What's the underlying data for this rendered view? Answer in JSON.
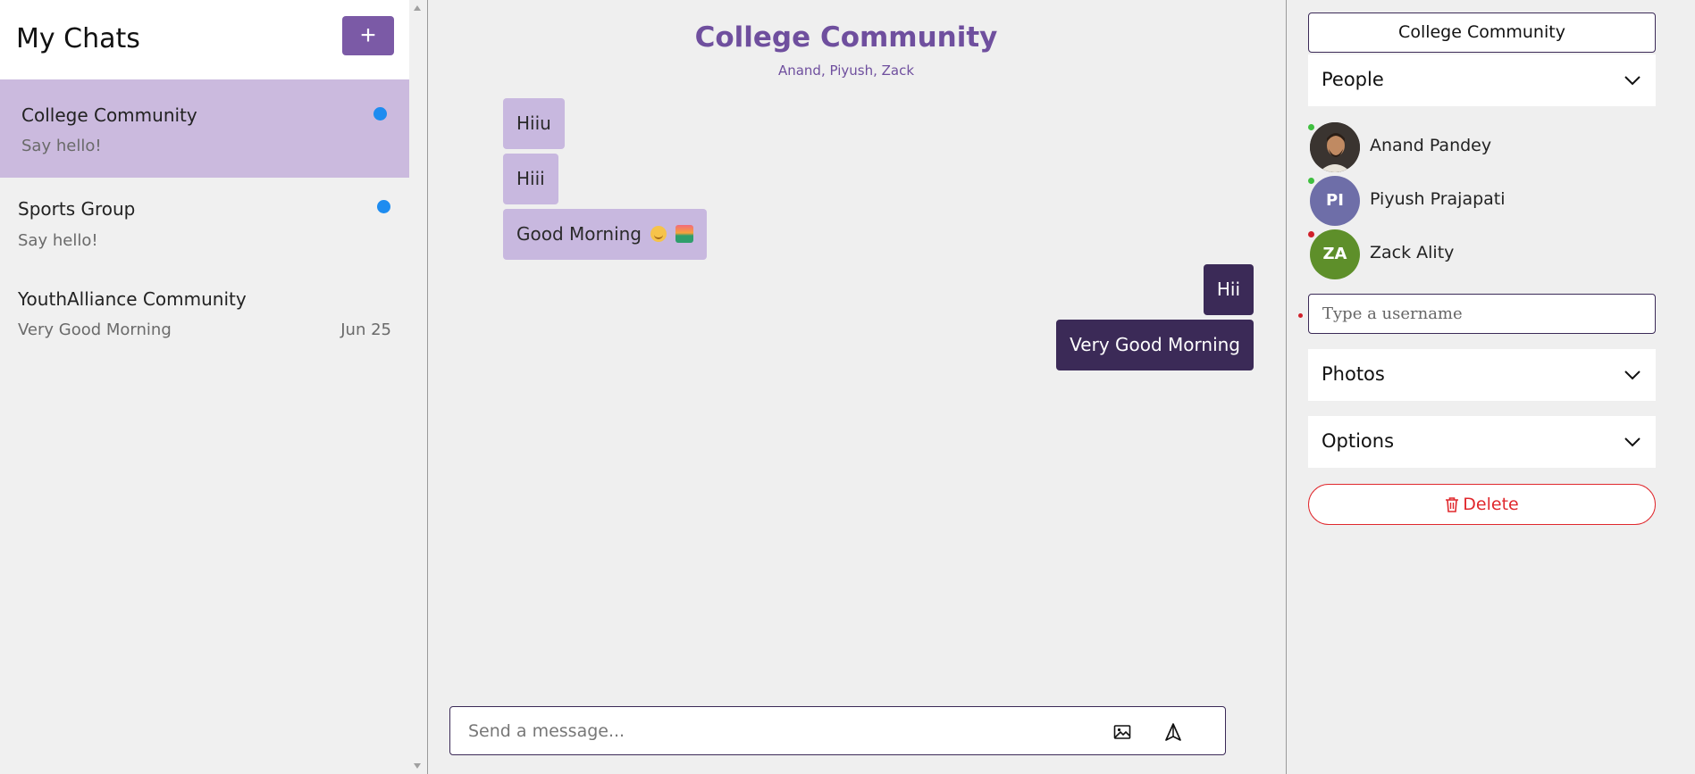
{
  "sidebar": {
    "title": "My Chats",
    "new_chat_label": "+",
    "chats": [
      {
        "name": "College Community",
        "preview": "Say hello!",
        "date": "",
        "unread": true,
        "active": true
      },
      {
        "name": "Sports Group",
        "preview": "Say hello!",
        "date": "",
        "unread": true,
        "active": false
      },
      {
        "name": "YouthAlliance Community",
        "preview": "Very Good Morning",
        "date": "Jun 25",
        "unread": false,
        "active": false
      }
    ]
  },
  "chat": {
    "title": "College Community",
    "members": "Anand, Piyush, Zack",
    "messages": [
      {
        "text": "Hiiu",
        "direction": "incoming"
      },
      {
        "text": "Hiii",
        "direction": "incoming"
      },
      {
        "text": "Good Morning",
        "direction": "incoming",
        "emoji": [
          "smiling-face-icon",
          "sunrise-icon"
        ]
      },
      {
        "text": "Hii",
        "direction": "outgoing"
      },
      {
        "text": "Very Good Morning",
        "direction": "outgoing"
      }
    ],
    "composer": {
      "placeholder": "Send a message...",
      "image_icon": "image-icon",
      "send_icon": "send-icon"
    }
  },
  "details": {
    "group_name": "College Community",
    "people_label": "People",
    "people": [
      {
        "name": "Anand Pandey",
        "initials": "",
        "avatar_color": "#2a2a2a",
        "status_color": "#3fbf3f",
        "avatar_type": "photo"
      },
      {
        "name": "Piyush Prajapati",
        "initials": "PI",
        "avatar_color": "#6e6ea8",
        "status_color": "#3fbf3f",
        "avatar_type": "initials"
      },
      {
        "name": "Zack Ality",
        "initials": "ZA",
        "avatar_color": "#5e8f2a",
        "status_color": "#d0202a",
        "avatar_type": "initials"
      }
    ],
    "username_placeholder": "Type a username",
    "photos_label": "Photos",
    "options_label": "Options",
    "delete_label": "Delete"
  },
  "colors": {
    "accent": "#7b5aa6",
    "title_purple": "#6f4f9e",
    "incoming_bubble": "#c8b8df",
    "outgoing_bubble": "#3b2a57",
    "active_chat": "#cbbade",
    "unread_dot": "#1e8cf0",
    "danger": "#e0282d"
  }
}
